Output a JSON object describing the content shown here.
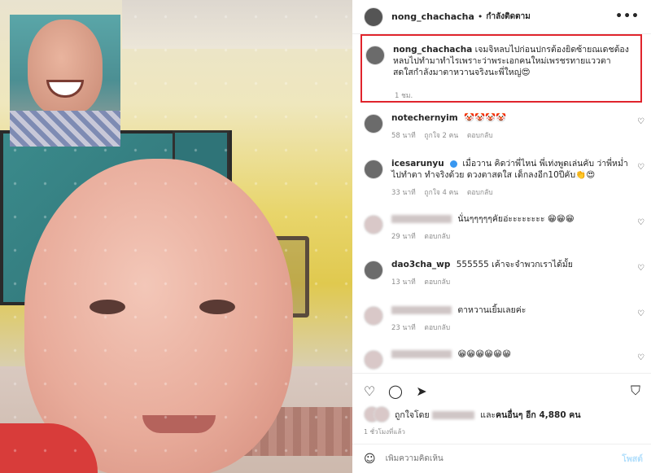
{
  "header": {
    "username": "nong_chachacha",
    "separator": "•",
    "follow_label": "กำลังติดตาม",
    "more_icon": "more-horizontal-icon"
  },
  "caption": {
    "username": "nong_chachacha",
    "text": "เจมจิหลบไปก่อนปกรต้องยิดซ้ายณเดชต้องหลบไปทำมาทำไรเพราะว่าพระเอกคนใหม่เพรชรทายแววตาสดใสกำลังมาตาหวานจริงนะพี่ใหญ่😍",
    "time": "1 ชม.",
    "highlight_color": "#e0242c"
  },
  "comments": [
    {
      "username": "notechernyim",
      "text": "🤡🤡🤡🤡",
      "time": "58 นาที",
      "likes": "ถูกใจ 2 คน",
      "reply": "ตอบกลับ",
      "blurred": false,
      "verified": false
    },
    {
      "username": "icesarunyu",
      "text": "เมื่อวาน คิดว่าพี่ไหน่ พี่เท่งพูดเล่นคับ ว่าพี่หม่ำ ไปทำตา ทำจริงด้วย ดวงตาสดใส เด็กลงอีก10ปีคับ👏😍",
      "time": "33 นาที",
      "likes": "ถูกใจ 4 คน",
      "reply": "ตอบกลับ",
      "blurred": false,
      "verified": true
    },
    {
      "username": "",
      "text": "นั่นๆๆๆๆๆคัยอ่ะะะะะะะะ 😁😁😁",
      "time": "29 นาที",
      "likes": "",
      "reply": "ตอบกลับ",
      "blurred": true,
      "verified": false
    },
    {
      "username": "dao3cha_wp",
      "text": "555555 เค้าจะจำพวกเราได้มั้ย",
      "time": "13 นาที",
      "likes": "",
      "reply": "ตอบกลับ",
      "blurred": false,
      "verified": false
    },
    {
      "username": "",
      "text": "ตาหวานเยิ้มเลยค่ะ",
      "time": "23 นาที",
      "likes": "",
      "reply": "ตอบกลับ",
      "blurred": true,
      "verified": false
    },
    {
      "username": "",
      "text": "😁😁😁😁😁😁",
      "time": "",
      "likes": "",
      "reply": "",
      "blurred": true,
      "verified": false
    }
  ],
  "actions": {
    "like_icon": "heart-icon",
    "comment_icon": "comment-icon",
    "share_icon": "send-icon",
    "save_icon": "bookmark-icon"
  },
  "likes": {
    "prefix": "ถูกใจโดย",
    "middle": "และ",
    "others_label": "คนอื่นๆ อีก 4,880 คน"
  },
  "post_time": "1 ชั่วโมงที่แล้ว",
  "add_comment": {
    "placeholder": "เพิ่มความคิดเห็น",
    "post_label": "โพสต์",
    "emoji_icon": "smiley-icon"
  }
}
